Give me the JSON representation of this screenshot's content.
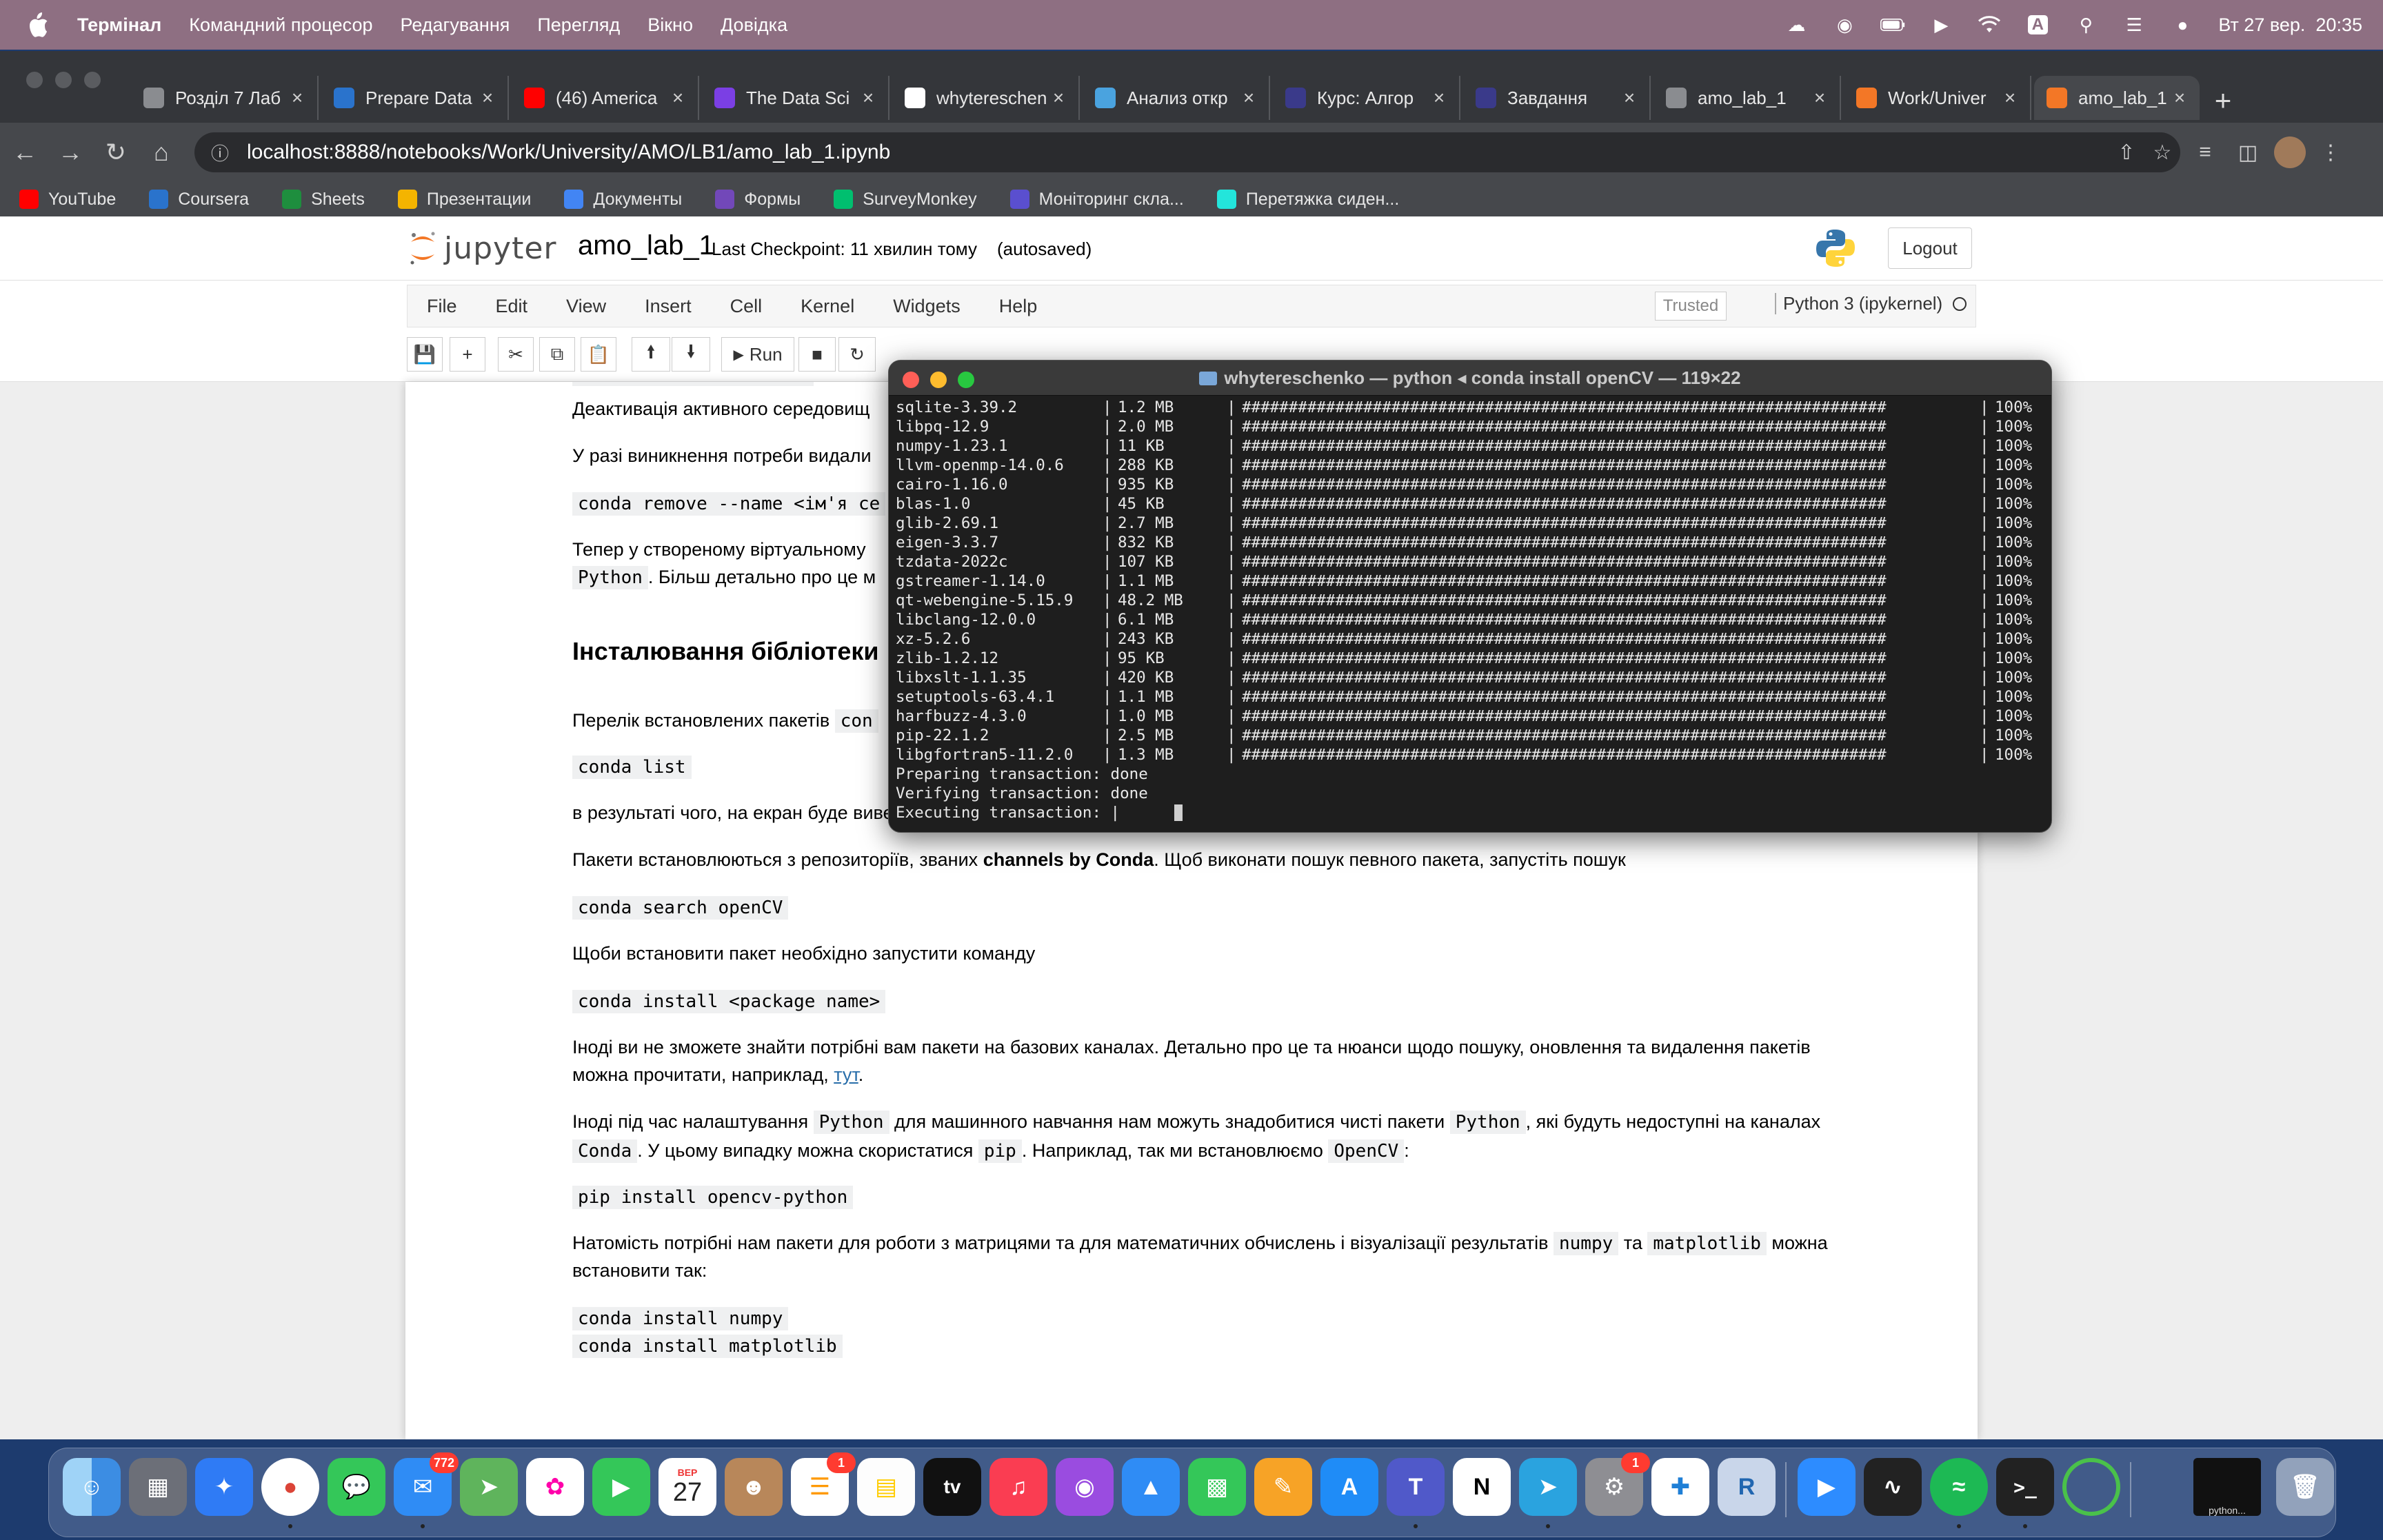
{
  "menubar": {
    "app": "Термінал",
    "items": [
      "Командний процесор",
      "Редагування",
      "Перегляд",
      "Вікно",
      "Довідка"
    ],
    "clock": "Вт 27 вер.  20:35",
    "input_source": "A"
  },
  "browser": {
    "tabs": [
      {
        "title": "Розділ 7 Лаб",
        "favicon": "globe-icon"
      },
      {
        "title": "Prepare Data",
        "favicon": "coursera-icon"
      },
      {
        "title": "(46) America",
        "favicon": "youtube-icon"
      },
      {
        "title": "The Data Sci",
        "favicon": "purple-t-icon"
      },
      {
        "title": "whytereschen",
        "favicon": "github-icon"
      },
      {
        "title": "Анализ откр",
        "favicon": "chart-icon"
      },
      {
        "title": "Курс: Алгор",
        "favicon": "course-icon"
      },
      {
        "title": "Завдання",
        "favicon": "course-icon"
      },
      {
        "title": "amo_lab_1",
        "favicon": "globe-icon"
      },
      {
        "title": "Work/Univer",
        "favicon": "jupyter-icon"
      },
      {
        "title": "amo_lab_1 -",
        "favicon": "jupyter-notebook-icon",
        "active": true
      }
    ],
    "url": "localhost:8888/notebooks/Work/University/AMO/LB1/amo_lab_1.ipynb",
    "bookmarks": [
      {
        "label": "YouTube",
        "icon": "youtube-icon",
        "color": "#ff0000"
      },
      {
        "label": "Coursera",
        "icon": "coursera-icon",
        "color": "#2a73cc"
      },
      {
        "label": "Sheets",
        "icon": "sheets-icon",
        "color": "#1e8e3e"
      },
      {
        "label": "Презентации",
        "icon": "slides-icon",
        "color": "#f4b400"
      },
      {
        "label": "Документы",
        "icon": "docs-icon",
        "color": "#4285f4"
      },
      {
        "label": "Формы",
        "icon": "forms-icon",
        "color": "#7248b9"
      },
      {
        "label": "SurveyMonkey",
        "icon": "surveymonkey-icon",
        "color": "#00bf6f"
      },
      {
        "label": "Моніторинг скла...",
        "icon": "monitoring-icon",
        "color": "#5a4fcf"
      },
      {
        "label": "Перетяжка сиден...",
        "icon": "olx-icon",
        "color": "#23e5db"
      }
    ]
  },
  "jupyter": {
    "brand": "jupyter",
    "notebook_name": "amo_lab_1",
    "checkpoint": "Last Checkpoint: 11 хвилин тому",
    "autosave": "(autosaved)",
    "logout": "Logout",
    "menu": [
      "File",
      "Edit",
      "View",
      "Insert",
      "Cell",
      "Kernel",
      "Widgets",
      "Help"
    ],
    "trusted": "Trusted",
    "kernel": "Python 3 (ipykernel)",
    "run_label": "Run"
  },
  "notebook": {
    "p_deactivate": "Деактивація активного середовищ",
    "p_remove": "У разі виникнення потреби видали",
    "code_remove": "conda remove --name <ім'я се",
    "p_now_1": "Тепер у створеному віртуальному ",
    "p_now_code": "Python",
    "p_now_2": ". Більш детально про це м",
    "h_install": "Інсталювання бібліотеки",
    "p_list": "Перелік встановлених пакетів ",
    "p_list_code": "con",
    "code_list": "conda list",
    "p_result": "в результаті чого, на екран буде виведено список пакетів активного середовища.",
    "p_channels_1": "Пакети встановлюються з репозиторіїв, званих ",
    "p_channels_bold": "channels by Conda",
    "p_channels_2": ". Щоб виконати пошук певного пакета, запустіть пошук",
    "code_search": "conda search openCV",
    "p_install_cmd": "Щоби встановити пакет необхідно запустити команду",
    "code_install": "conda install <package name>",
    "p_sometimes_1": "Іноді ви не зможете знайти потрібні вам пакети на базових каналах. Детально про це та нюанси щодо пошуку, оновлення та видалення пакетів",
    "p_sometimes_2": "можна прочитати, наприклад, ",
    "p_sometimes_link": "тут",
    "p_sometimes_3": ".",
    "p_pip_a": "Іноді під час налаштування ",
    "p_pip_code1": "Python",
    "p_pip_b": " для машинного навчання нам можуть знадобитися чисті пакети ",
    "p_pip_code2": "Python",
    "p_pip_c": ", які будуть недоступні на каналах",
    "p_pip_code3": "Conda",
    "p_pip_d": ". У цьому випадку можна скористатися ",
    "p_pip_code4": "pip",
    "p_pip_e": ". Наприклад, так ми встановлюємо ",
    "p_pip_code5": "OpenCV",
    "p_pip_f": ":",
    "code_pip": "pip install opencv-python",
    "p_numpy_a": "Натомість потрібні нам пакети для роботи з матрицями та для математичних обчислень і візуалізації результатів ",
    "p_numpy_code1": "numpy",
    "p_numpy_b": " та ",
    "p_numpy_code2": "matplotlib",
    "p_numpy_c": " можна",
    "p_numpy_d": "встановити так:",
    "code_numpy": "conda install numpy",
    "code_matplotlib": "conda install matplotlib"
  },
  "terminal": {
    "title": "whytereschenko — python ◂ conda install openCV — 119×22",
    "packages": [
      {
        "name": "sqlite-3.39.2",
        "size": "1.2 MB",
        "pct": "100%"
      },
      {
        "name": "libpq-12.9",
        "size": "2.0 MB",
        "pct": "100%"
      },
      {
        "name": "numpy-1.23.1",
        "size": "11 KB",
        "pct": "100%"
      },
      {
        "name": "llvm-openmp-14.0.6",
        "size": "288 KB",
        "pct": "100%"
      },
      {
        "name": "cairo-1.16.0",
        "size": "935 KB",
        "pct": "100%"
      },
      {
        "name": "blas-1.0",
        "size": "45 KB",
        "pct": "100%"
      },
      {
        "name": "glib-2.69.1",
        "size": "2.7 MB",
        "pct": "100%"
      },
      {
        "name": "eigen-3.3.7",
        "size": "832 KB",
        "pct": "100%"
      },
      {
        "name": "tzdata-2022c",
        "size": "107 KB",
        "pct": "100%"
      },
      {
        "name": "gstreamer-1.14.0",
        "size": "1.1 MB",
        "pct": "100%"
      },
      {
        "name": "qt-webengine-5.15.9",
        "size": "48.2 MB",
        "pct": "100%"
      },
      {
        "name": "libclang-12.0.0",
        "size": "6.1 MB",
        "pct": "100%"
      },
      {
        "name": "xz-5.2.6",
        "size": "243 KB",
        "pct": "100%"
      },
      {
        "name": "zlib-1.2.12",
        "size": "95 KB",
        "pct": "100%"
      },
      {
        "name": "libxslt-1.1.35",
        "size": "420 KB",
        "pct": "100%"
      },
      {
        "name": "setuptools-63.4.1",
        "size": "1.1 MB",
        "pct": "100%"
      },
      {
        "name": "harfbuzz-4.3.0",
        "size": "1.0 MB",
        "pct": "100%"
      },
      {
        "name": "pip-22.1.2",
        "size": "2.5 MB",
        "pct": "100%"
      },
      {
        "name": "libgfortran5-11.2.0",
        "size": "1.3 MB",
        "pct": "100%"
      }
    ],
    "progress_bar": "#####################################################################",
    "lines": [
      "Preparing transaction: done",
      "Verifying transaction: done",
      "Executing transaction: | "
    ]
  },
  "dock": {
    "mail_badge": "772",
    "calendar_month": "ВЕР",
    "calendar_day": "27",
    "reminders_badge": "1",
    "settings_badge": "1",
    "tv_label": "tv",
    "rstudio_label": "R",
    "terminal_label": ">_",
    "minimized_label": "python..."
  }
}
